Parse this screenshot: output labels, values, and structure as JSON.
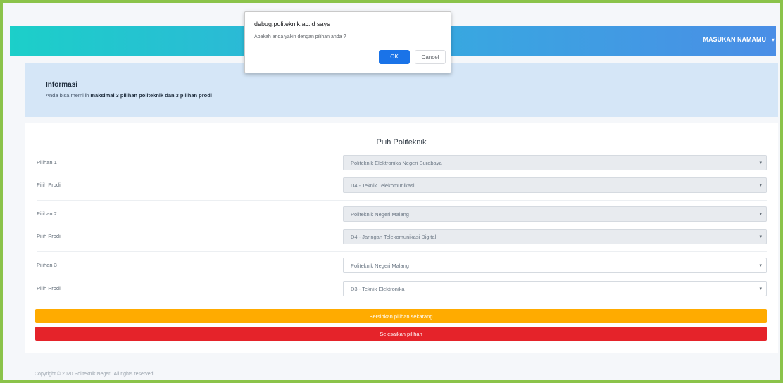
{
  "header": {
    "user_name": "MASUKAN NAMAMU"
  },
  "info": {
    "title": "Informasi",
    "text_prefix": "Anda bisa memilih ",
    "text_bold": "maksimal 3 pilihan politeknik dan 3 pilihan prodi"
  },
  "form": {
    "title": "Pilih Politeknik",
    "groups": [
      {
        "choice_label": "Pilihan 1",
        "poltek_value": "Politeknik Elektronika Negeri Surabaya",
        "prodi_label": "Pilih Prodi",
        "prodi_value": "D4 - Teknik Telekomunikasi"
      },
      {
        "choice_label": "Pilihan 2",
        "poltek_value": "Politeknik Negeri Malang",
        "prodi_label": "Pilih Prodi",
        "prodi_value": "D4 - Jaringan Telekomunikasi Digital"
      },
      {
        "choice_label": "Pilihan 3",
        "poltek_value": "Politeknik Negeri Malang",
        "prodi_label": "Pilih Prodi",
        "prodi_value": "D3 - Teknik Elektronika"
      }
    ],
    "reset_button": "Bersihkan pilihan sekarang",
    "save_button": "Selesaikan pilihan"
  },
  "footer": {
    "text": "Copyright © 2020 Politeknik Negeri. All rights reserved."
  },
  "dialog": {
    "origin": "debug.politeknik.ac.id says",
    "message": "Apakah anda yakin dengan pilihan anda ?",
    "ok_label": "OK",
    "cancel_label": "Cancel"
  },
  "colors": {
    "border_accent": "#8bc34a",
    "header_gradient_start": "#1ccfc9",
    "header_gradient_end": "#4a8ee6",
    "info_bg": "#d5e6f7",
    "reset_button": "#ffab00",
    "save_button": "#e5232a",
    "dialog_ok": "#1a73e8"
  },
  "icons": {
    "dropdown": "chevron-down-icon"
  }
}
